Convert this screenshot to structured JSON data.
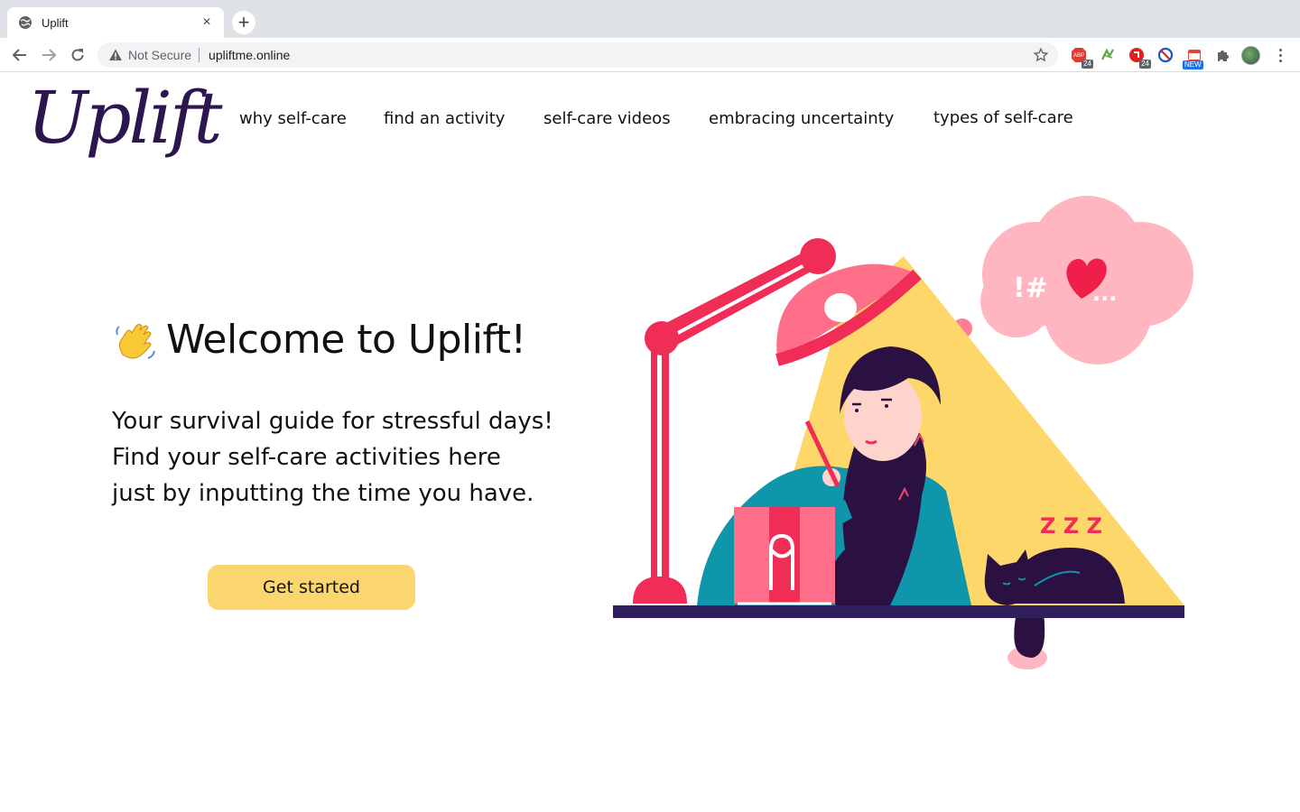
{
  "browser": {
    "tab_title": "Uplift",
    "tab_close": "×",
    "new_tab": "+",
    "security_label": "Not Secure",
    "url": "upliftme.online",
    "extensions": [
      {
        "name": "adblock",
        "badge": "24"
      },
      {
        "name": "grammar"
      },
      {
        "name": "pdf",
        "badge": "24"
      },
      {
        "name": "block"
      },
      {
        "name": "calendar",
        "badge": "NEW"
      },
      {
        "name": "puzzle"
      }
    ]
  },
  "site": {
    "logo": "Uplift",
    "nav": [
      "why self-care",
      "find an activity",
      "self-care videos",
      "embracing uncertainty",
      "types of self-care"
    ]
  },
  "hero": {
    "wave_emoji": "👋",
    "headline": "Welcome to Uplift!",
    "subtitle_lines": [
      "Your survival guide for stressful days!",
      "Find your self-care activities here",
      "just by inputting the time you have."
    ],
    "cta_label": "Get started"
  },
  "illustration": {
    "thought_text": "!#",
    "thought_ellipsis": "...",
    "snore_text": "Z Z Z"
  },
  "colors": {
    "logo": "#2d1650",
    "cta": "#fbd66e",
    "lamp": "#ef2d56",
    "light": "#fdd76a",
    "cloud": "#ffb6c1",
    "sweater": "#0f96ab",
    "hair": "#2a1141",
    "desk": "#2f1e5c"
  }
}
